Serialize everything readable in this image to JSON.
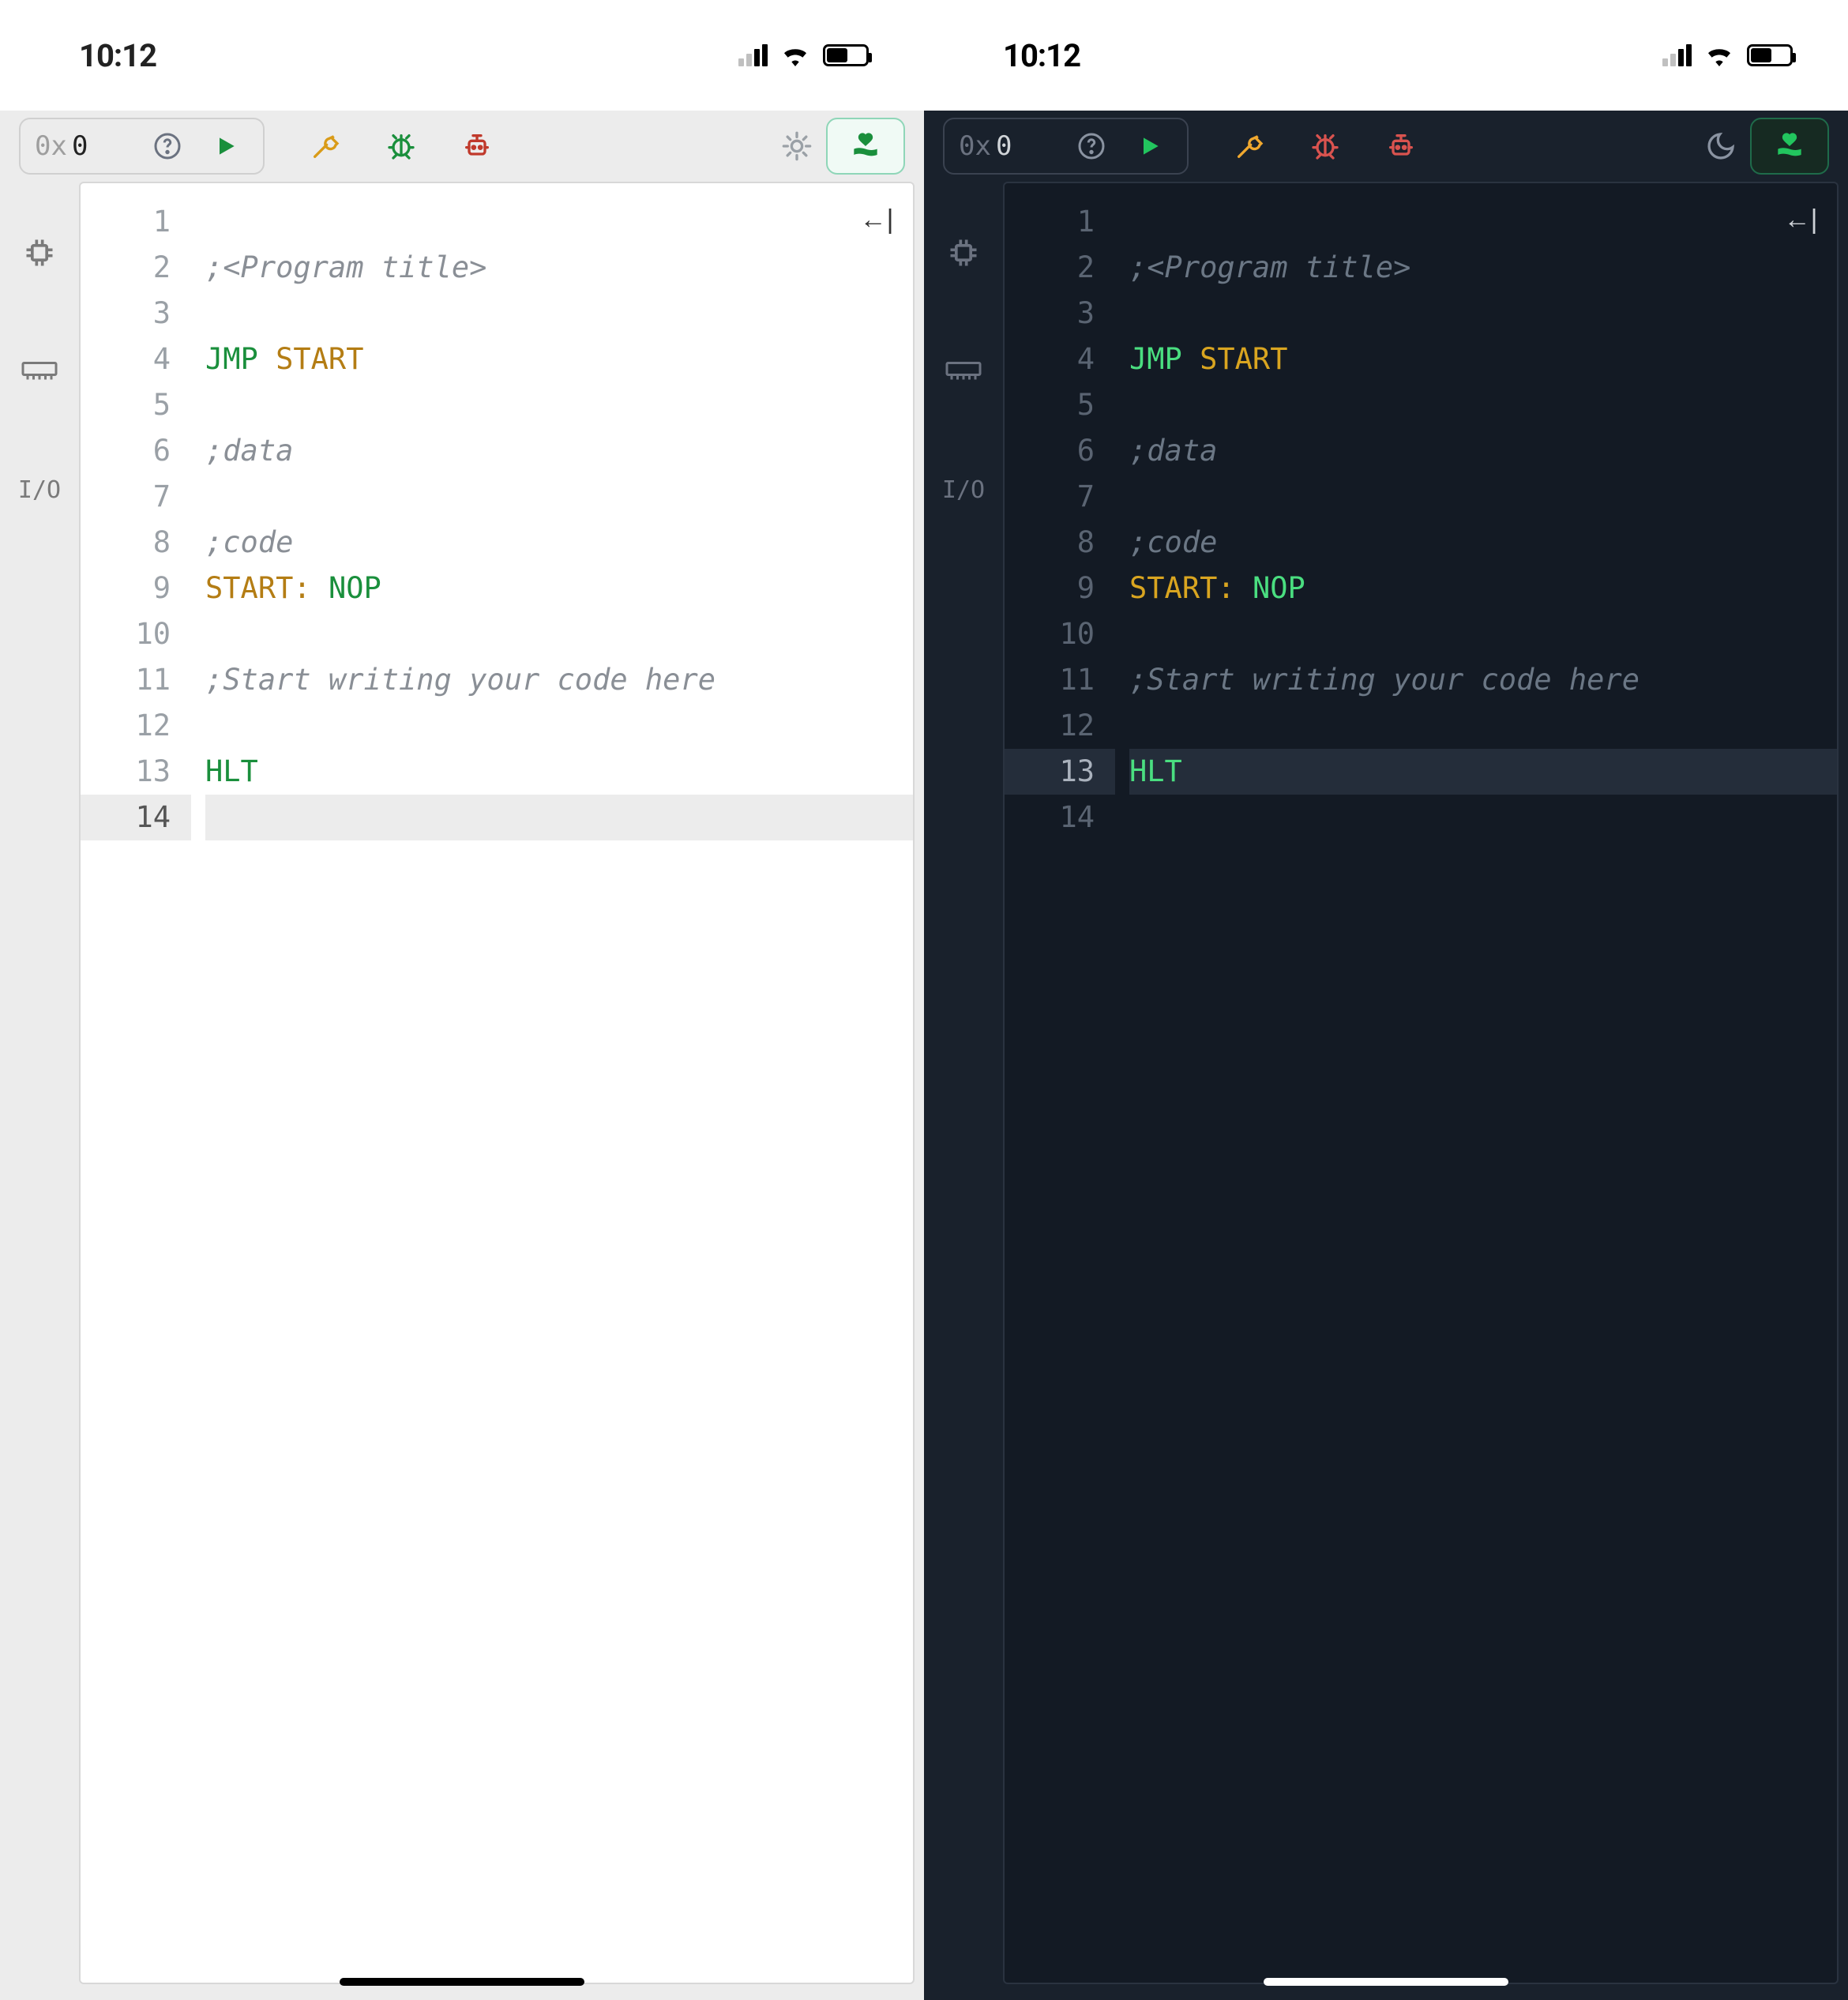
{
  "status": {
    "time": "10:12",
    "battery_pct": 55
  },
  "toolbar": {
    "addr_prefix": "0x",
    "addr_value": "0",
    "icons": {
      "help": "help-icon",
      "run": "play-icon",
      "tools": "wrench-icon",
      "debug": "bug-icon",
      "compile": "robot-icon",
      "theme_light": "sun-icon",
      "theme_dark": "moon-icon",
      "donate": "heart-hand-icon"
    },
    "colors": {
      "run": "#1a8f3c",
      "tools": "#d99b18",
      "debug_light": "#1a8f3c",
      "debug_dark": "#d9534f",
      "compile": "#c0392b",
      "donate": "#1a8f3c"
    }
  },
  "siderail": {
    "cpu": "cpu-icon",
    "memory": "memory-icon",
    "io_label": "I/O"
  },
  "editor": {
    "line_count": 14,
    "active_line_light": 14,
    "active_line_dark": 13,
    "lines": [
      {
        "n": 1,
        "tokens": []
      },
      {
        "n": 2,
        "tokens": [
          {
            "t": "comment",
            "v": ";<Program title>"
          }
        ]
      },
      {
        "n": 3,
        "tokens": []
      },
      {
        "n": 4,
        "tokens": [
          {
            "t": "keyword",
            "v": "JMP "
          },
          {
            "t": "ident",
            "v": "START"
          }
        ]
      },
      {
        "n": 5,
        "tokens": []
      },
      {
        "n": 6,
        "tokens": [
          {
            "t": "comment",
            "v": ";data"
          }
        ]
      },
      {
        "n": 7,
        "tokens": []
      },
      {
        "n": 8,
        "tokens": [
          {
            "t": "comment",
            "v": ";code"
          }
        ]
      },
      {
        "n": 9,
        "tokens": [
          {
            "t": "ident",
            "v": "START: "
          },
          {
            "t": "keyword",
            "v": "NOP"
          }
        ]
      },
      {
        "n": 10,
        "tokens": []
      },
      {
        "n": 11,
        "tokens": [
          {
            "t": "comment",
            "v": ";Start writing your code here"
          }
        ]
      },
      {
        "n": 12,
        "tokens": []
      },
      {
        "n": 13,
        "tokens": [
          {
            "t": "keyword",
            "v": "HLT"
          }
        ]
      },
      {
        "n": 14,
        "tokens": []
      }
    ]
  },
  "collapse_glyph": "←|"
}
